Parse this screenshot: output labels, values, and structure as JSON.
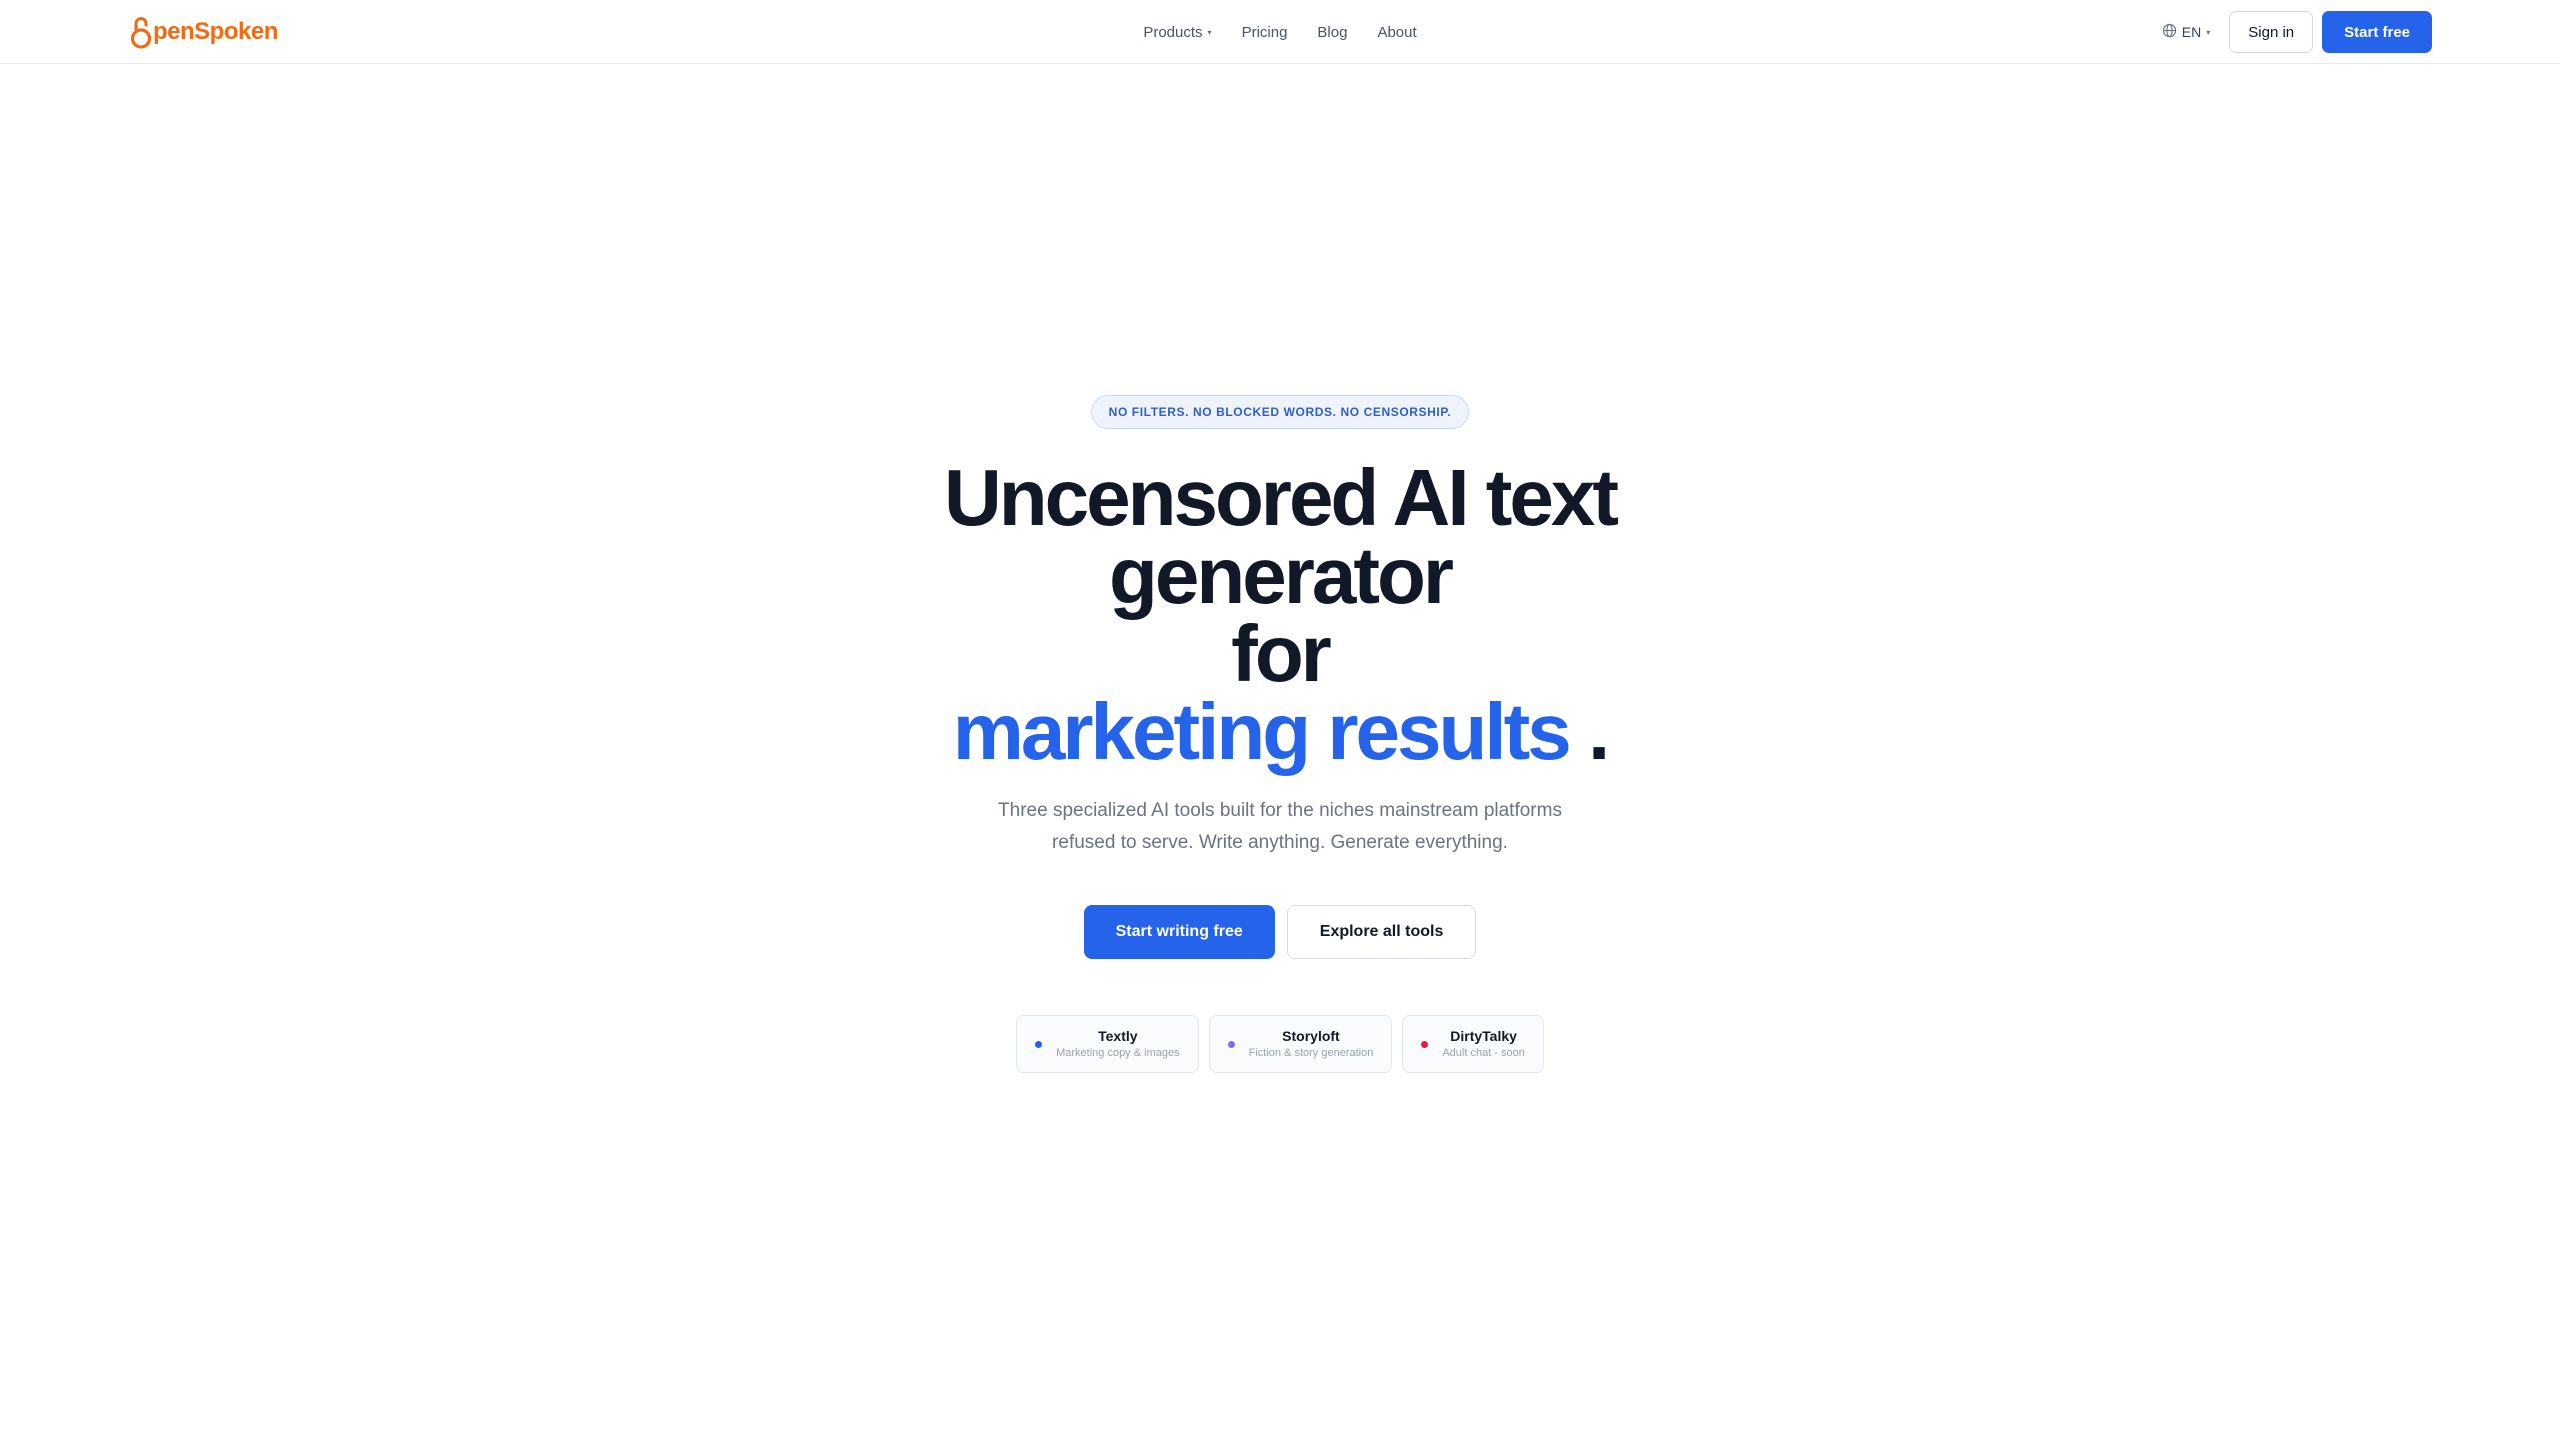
{
  "brand": {
    "name_rest": "penSpoken",
    "color": "#f26a12"
  },
  "nav": {
    "items": [
      {
        "label": "Products",
        "has_dropdown": true
      },
      {
        "label": "Pricing",
        "has_dropdown": false
      },
      {
        "label": "Blog",
        "has_dropdown": false
      },
      {
        "label": "About",
        "has_dropdown": false
      }
    ]
  },
  "header": {
    "language": "EN",
    "sign_in": "Sign in",
    "start_free": "Start free"
  },
  "hero": {
    "badge": "NO FILTERS. NO BLOCKED WORDS. NO CENSORSHIP.",
    "headline_line1": "Uncensored AI text",
    "headline_line2": "generator",
    "headline_line3": "for",
    "headline_accent": "marketing results",
    "headline_period": ".",
    "subtitle": "Three specialized AI tools built for the niches mainstream platforms refused to serve. Write anything. Generate everything.",
    "cta_primary": "Start writing free",
    "cta_secondary": "Explore all tools"
  },
  "tools": [
    {
      "name": "Textly",
      "desc": "Marketing copy & images",
      "dot_color": "#2563eb"
    },
    {
      "name": "Storyloft",
      "desc": "Fiction & story generation",
      "dot_color": "#7c6cf0"
    },
    {
      "name": "DirtyTalky",
      "desc": "Adult chat - soon",
      "dot_color": "#e11d48"
    }
  ],
  "colors": {
    "accent": "#2563eb",
    "text": "#111827",
    "muted": "#6b7280"
  }
}
